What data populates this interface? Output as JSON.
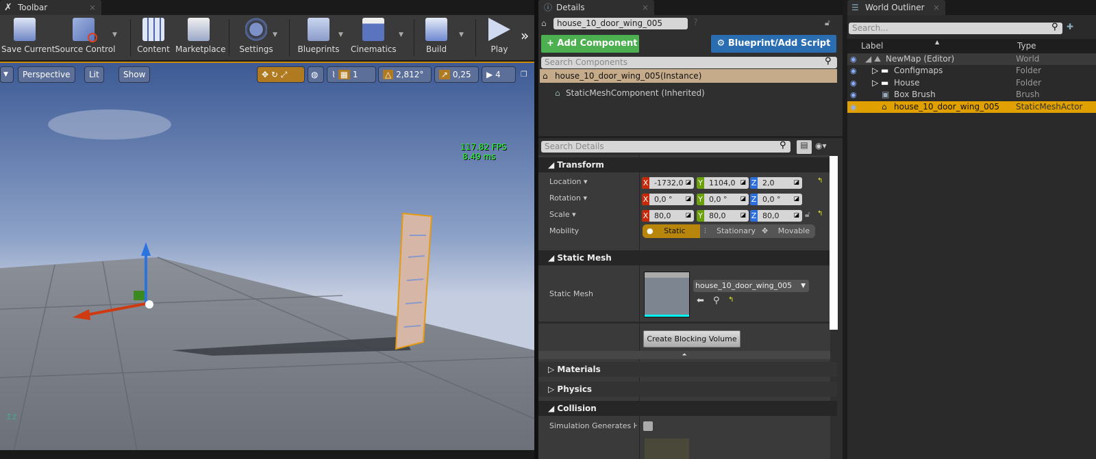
{
  "toolbar": {
    "tab": "Toolbar",
    "buttons": [
      {
        "label": "Save Current",
        "icon": "floppy-disk-icon"
      },
      {
        "label": "Source Control",
        "icon": "source-control-icon"
      },
      {
        "label": "Content",
        "icon": "content-browser-icon"
      },
      {
        "label": "Marketplace",
        "icon": "marketplace-icon"
      },
      {
        "label": "Settings",
        "icon": "gear-icon"
      },
      {
        "label": "Blueprints",
        "icon": "gamepad-icon"
      },
      {
        "label": "Cinematics",
        "icon": "clapperboard-icon"
      },
      {
        "label": "Build",
        "icon": "build-icon"
      },
      {
        "label": "Play",
        "icon": "play-icon"
      }
    ],
    "more": "»"
  },
  "viewport": {
    "perspective": "Perspective",
    "lit": "Lit",
    "show": "Show",
    "grid_snap": "1",
    "rotation_snap": "2,812°",
    "scale_snap": "0,25",
    "camera_speed": "4",
    "fps": "117.82 FPS",
    "ms": "8.49 ms"
  },
  "details": {
    "tab": "Details",
    "actor_name": "house_10_door_wing_005",
    "add_component": "Add Component",
    "blueprint_script": "Blueprint/Add Script",
    "search_components_placeholder": "Search Components",
    "instance": "house_10_door_wing_005(Instance)",
    "component": "StaticMeshComponent (Inherited)",
    "search_details_placeholder": "Search Details",
    "transform": {
      "header": "Transform",
      "location": {
        "label": "Location",
        "x": "-1732,0",
        "y": "1104,0",
        "z": "2,0"
      },
      "rotation": {
        "label": "Rotation",
        "x": "0,0 °",
        "y": "0,0 °",
        "z": "0,0 °"
      },
      "scale": {
        "label": "Scale",
        "x": "80,0",
        "y": "80,0",
        "z": "80,0"
      },
      "mobility": {
        "label": "Mobility",
        "options": [
          "Static",
          "Stationary",
          "Movable"
        ],
        "selected": "Static"
      }
    },
    "static_mesh": {
      "header": "Static Mesh",
      "label": "Static Mesh",
      "value": "house_10_door_wing_005"
    },
    "create_blocking_volume": "Create Blocking Volume",
    "materials": "Materials",
    "physics": "Physics",
    "collision": "Collision",
    "sim_hit": "Simulation Generates Hit E"
  },
  "outliner": {
    "tab": "World Outliner",
    "search_placeholder": "Search...",
    "col_label": "Label",
    "col_type": "Type",
    "rows": [
      {
        "label": "NewMap (Editor)",
        "type": "World"
      },
      {
        "label": "Configmaps",
        "type": "Folder"
      },
      {
        "label": "House",
        "type": "Folder"
      },
      {
        "label": "Box Brush",
        "type": "Brush"
      },
      {
        "label": "house_10_door_wing_005",
        "type": "StaticMeshActor"
      }
    ]
  },
  "colors": {
    "accent": "#d08c00",
    "selected_row": "#e0a000",
    "green_button": "#4caf50",
    "blue_button": "#2a6db0",
    "x_axis": "#c62a0a",
    "y_axis": "#6aa10a",
    "z_axis": "#2a6fdb"
  }
}
